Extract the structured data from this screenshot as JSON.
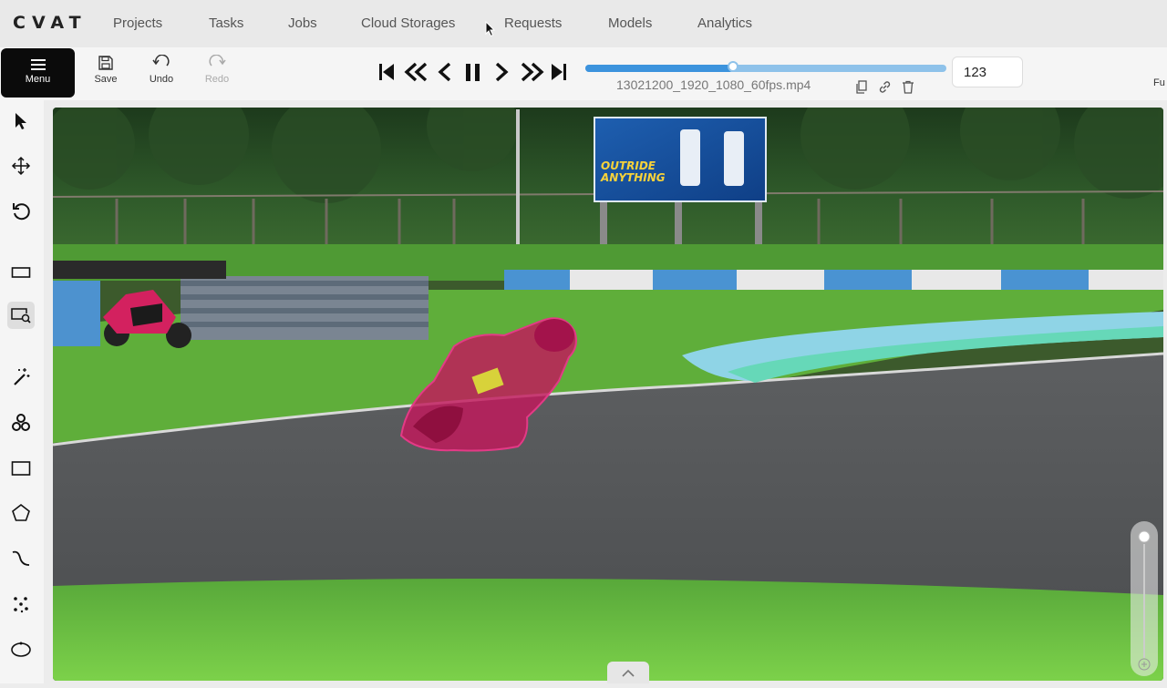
{
  "app": {
    "logo": "CVAT"
  },
  "nav": {
    "projects": "Projects",
    "tasks": "Tasks",
    "jobs": "Jobs",
    "cloud_storages": "Cloud Storages",
    "requests": "Requests",
    "models": "Models",
    "analytics": "Analytics"
  },
  "toolbar": {
    "menu": "Menu",
    "save": "Save",
    "undo": "Undo",
    "redo": "Redo",
    "filename": "13021200_1920_1080_60fps.mp4",
    "frame_number": "123",
    "fullscreen_partial": "Fu",
    "timeline_progress": 0.41
  },
  "icons": {
    "first": "first-frame-icon",
    "back_fast": "fast-backward-icon",
    "back": "previous-frame-icon",
    "pause": "pause-icon",
    "next": "next-frame-icon",
    "forward_fast": "fast-forward-icon",
    "last": "last-frame-icon"
  },
  "canvas": {
    "billboard_text_1": "OUTRIDE",
    "billboard_text_2": "ANYTHING"
  },
  "colors": {
    "mask": "#c2185b",
    "timeline": "#3c93dd"
  }
}
